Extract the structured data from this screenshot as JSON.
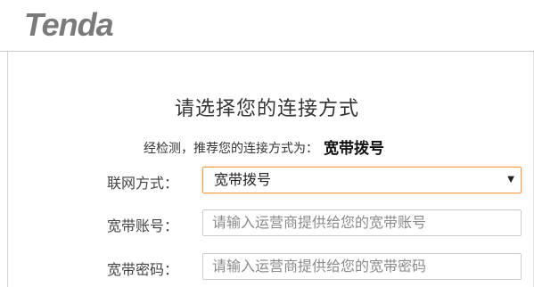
{
  "header": {
    "logo_text": "Tenda",
    "logo_color": "#7a7a7a"
  },
  "main": {
    "title": "请选择您的连接方式",
    "detect_prefix": "经检测，推荐您的连接方式为：",
    "detect_value": "宽带拨号",
    "connection_type": {
      "label": "联网方式：",
      "selected": "宽带拨号"
    },
    "account": {
      "label": "宽带账号：",
      "placeholder": "请输入运营商提供给您的宽带账号"
    },
    "password": {
      "label": "宽带密码：",
      "placeholder": "请输入运营商提供给您的宽带密码"
    }
  },
  "colors": {
    "select_focus_border": "#f0a050",
    "text": "#333333"
  }
}
